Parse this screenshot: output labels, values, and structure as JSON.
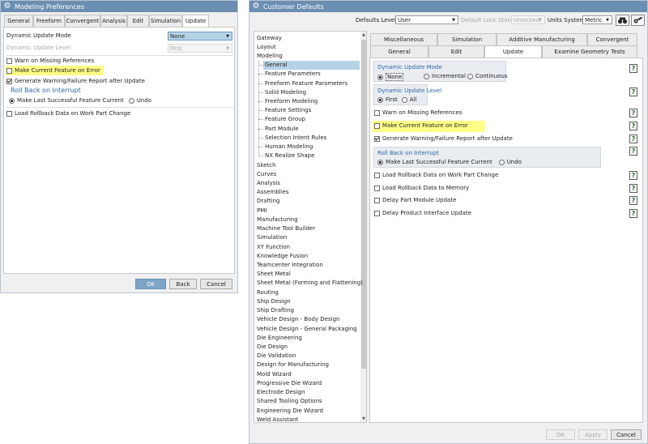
{
  "left": {
    "title": "Modeling Preferences",
    "tabs": [
      "General",
      "Freeform",
      "Convergent",
      "Analysis",
      "Edit",
      "Simulation",
      "Update"
    ],
    "dynamic_update_mode": {
      "label": "Dynamic Update Mode",
      "value": "None"
    },
    "dynamic_update_level": {
      "label": "Dynamic Update Level",
      "value": "First"
    },
    "warn_missing": "Warn on Missing References",
    "make_current_feature": "Make Current Feature on Error",
    "generate_report": "Generate Warning/Failure Report after Update",
    "rollback_title": "Roll Back on Interrupt",
    "rollback_opt1": "Make Last Successful Feature Current",
    "rollback_opt2": "Undo",
    "load_rollback": "Load Rollback Data on Work Part Change",
    "buttons": {
      "ok": "OK",
      "back": "Back",
      "cancel": "Cancel"
    }
  },
  "right": {
    "title": "Customer Defaults",
    "toolbar": {
      "defaults_level_label": "Defaults Level",
      "defaults_level_value": "User",
      "lock_state_label": "Default Lock State",
      "lock_state_value": "Unlocked",
      "units_label": "Units System",
      "units_value": "Metric"
    },
    "tree": [
      {
        "label": "Gateway"
      },
      {
        "label": "Layout"
      },
      {
        "label": "Modeling"
      },
      {
        "label": "General"
      },
      {
        "label": "Feature Parameters"
      },
      {
        "label": "Freeform Feature Parameters"
      },
      {
        "label": "Solid Modeling"
      },
      {
        "label": "Freeform Modeling"
      },
      {
        "label": "Feature Settings"
      },
      {
        "label": "Feature Group"
      },
      {
        "label": "Part Module"
      },
      {
        "label": "Selection Intent Rules"
      },
      {
        "label": "Human Modeling"
      },
      {
        "label": "NX Realize Shape"
      },
      {
        "label": "Sketch"
      },
      {
        "label": "Curves"
      },
      {
        "label": "Analysis"
      },
      {
        "label": "Assemblies"
      },
      {
        "label": "Drafting"
      },
      {
        "label": "PMI"
      },
      {
        "label": "Manufacturing"
      },
      {
        "label": "Machine Tool Builder"
      },
      {
        "label": "Simulation"
      },
      {
        "label": "XY Function"
      },
      {
        "label": "Knowledge Fusion"
      },
      {
        "label": "Teamcenter Integration"
      },
      {
        "label": "Sheet Metal"
      },
      {
        "label": "Sheet Metal (Forming and Flattening)"
      },
      {
        "label": "Routing"
      },
      {
        "label": "Ship Design"
      },
      {
        "label": "Ship Drafting"
      },
      {
        "label": "Vehicle Design - Body Design"
      },
      {
        "label": "Vehicle Design - General Packaging"
      },
      {
        "label": "Die Engineering"
      },
      {
        "label": "Die Design"
      },
      {
        "label": "Die Validation"
      },
      {
        "label": "Design for Manufacturing"
      },
      {
        "label": "Mold Wizard"
      },
      {
        "label": "Progressive Die Wizard"
      },
      {
        "label": "Electrode Design"
      },
      {
        "label": "Shared Tooling Options"
      },
      {
        "label": "Engineering Die Wizard"
      },
      {
        "label": "Weld Assistant"
      }
    ],
    "tabs_top": [
      "Miscellaneous",
      "Simulation",
      "Additive Manufacturing",
      "Convergent"
    ],
    "tabs_bottom": [
      "General",
      "Edit",
      "Update",
      "Examine Geometry Tests"
    ],
    "dum_title": "Dynamic Update Mode",
    "dum_opts": [
      "None",
      "Incremental",
      "Continuous"
    ],
    "dul_title": "Dynamic Update Level",
    "dul_opts": [
      "First",
      "All"
    ],
    "warn_missing": "Warn on Missing References",
    "make_current_feature": "Make Current Feature on Error",
    "generate_report": "Generate Warning/Failure Report after Update",
    "rollback_title": "Roll Back on Interrupt",
    "rollback_opt1": "Make Last Successful Feature Current",
    "rollback_opt2": "Undo",
    "load_rollback": "Load Rollback Data on Work Part Change",
    "load_memory": "Load Rollback Data to Memory",
    "delay_part": "Delay Part Module Update",
    "delay_interface": "Delay Product Interface Update",
    "help_glyph": "?",
    "buttons": {
      "ok": "OK",
      "apply": "Apply",
      "cancel": "Cancel"
    }
  },
  "colors": {
    "titlebar": "#6b8fb2",
    "highlight": "#fffe86",
    "selection": "#b6d2e5",
    "section": "#2b67a1"
  }
}
